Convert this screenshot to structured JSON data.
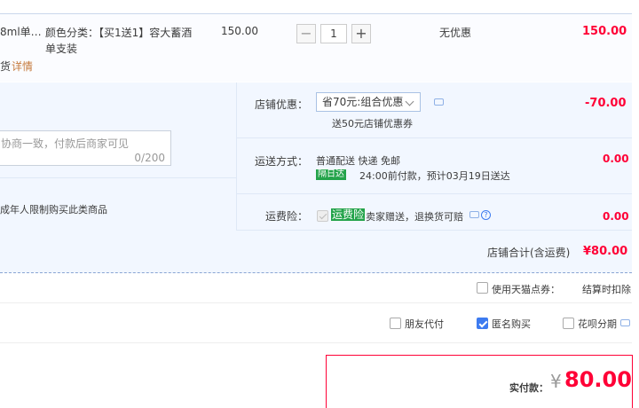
{
  "item": {
    "name_fragment": "8ml单…",
    "delivery_fragment": "货",
    "detail_link": "详情",
    "sku_line1": "颜色分类：【买1送1】容大蓄酒",
    "sku_line2": "单支装",
    "unit_price": "150.00",
    "quantity": "1",
    "minus": "−",
    "plus": "+",
    "discount": "无优惠",
    "subtotal": "150.00"
  },
  "shop_options": {
    "message_placeholder": "协商一致，付款后商家可见",
    "message_counter": "0/200",
    "age_notice": "成年人限制购买此类商品",
    "discount_label": "店铺优惠：",
    "discount_selected": "省70元:组合优惠",
    "discount_note": "送50元店铺优惠券",
    "discount_amount": "-70.00",
    "shipping_label": "运送方式：",
    "shipping_line1": "普通配送 快递 免邮",
    "shipping_badge": "隔日达",
    "shipping_line2": "24:00前付款，预计03月19日送达",
    "shipping_amount": "0.00",
    "insurance_label": "运费险：",
    "insurance_badge": "运费险",
    "insurance_text": "卖家赠送，退换货可赔",
    "insurance_help": "?",
    "insurance_amount": "0.00",
    "total_label": "店铺合计(含运费)",
    "total_amount": "¥80.00"
  },
  "points": {
    "label": "使用天猫点券：",
    "note": "结算时扣除"
  },
  "pay_options": {
    "friend_pay": "朋友代付",
    "anonymous": "匿名购买",
    "anonymous_checked": true,
    "huabei": "花呗分期"
  },
  "payment": {
    "label": "实付款：",
    "currency": "¥",
    "amount": "80.00"
  },
  "colors": {
    "accent_red": "#ff0036",
    "option_bg": "#f2f7ff",
    "checkbox_blue": "#3d7bf0",
    "badge_green": "#23a34a"
  }
}
